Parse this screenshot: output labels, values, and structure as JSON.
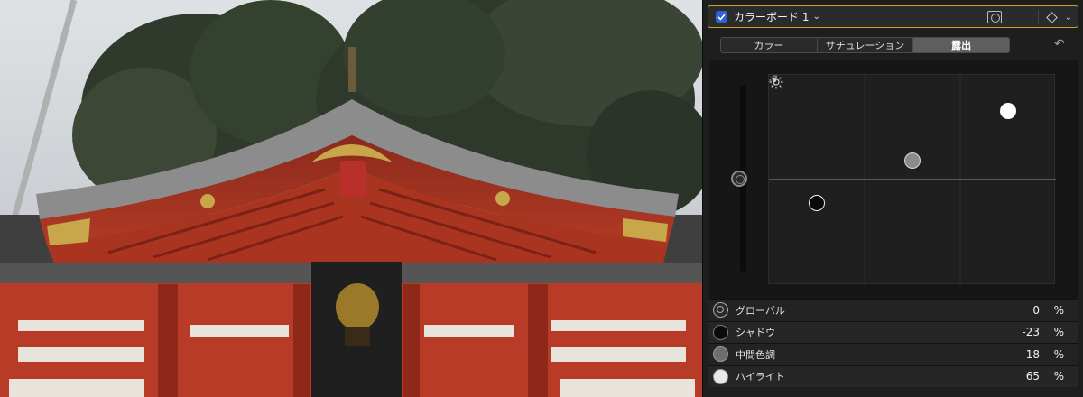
{
  "viewer": {
    "image_subject": "shrine-roof-photo"
  },
  "effect": {
    "enabled": true,
    "name": "カラーボード 1",
    "icons": {
      "mask": "mask-icon",
      "keyframe": "diamond-icon",
      "expand": "chevron-down-icon"
    }
  },
  "tabs": [
    {
      "label": "カラー",
      "active": false
    },
    {
      "label": "サチュレーション",
      "active": false
    },
    {
      "label": "露出",
      "active": true
    }
  ],
  "board": {
    "pucks": {
      "global": 0,
      "shadows": -23,
      "midtones": 18,
      "highlights": 65
    }
  },
  "rows": [
    {
      "label": "グローバル",
      "value": "0",
      "unit": "%"
    },
    {
      "label": "シャドウ",
      "value": "-23",
      "unit": "%"
    },
    {
      "label": "中間色調",
      "value": "18",
      "unit": "%"
    },
    {
      "label": "ハイライト",
      "value": "65",
      "unit": "%"
    }
  ],
  "colors": {
    "accent_border": "#c9a227",
    "checkbox": "#2f62d8",
    "panel_bg": "#1e1e1e"
  }
}
